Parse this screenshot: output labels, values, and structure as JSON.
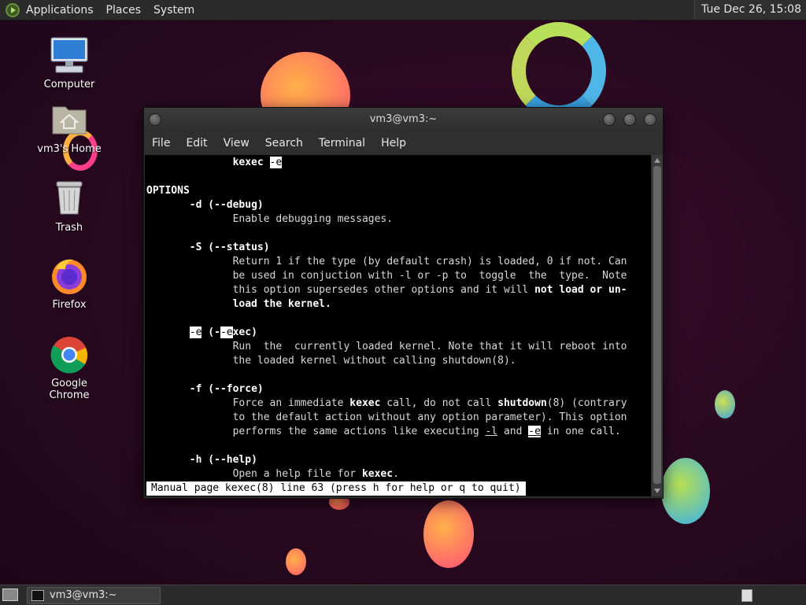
{
  "top_panel": {
    "menus": [
      "Applications",
      "Places",
      "System"
    ],
    "clock": "Tue Dec 26, 15:08"
  },
  "desktop_icons": [
    {
      "label": "Computer",
      "icon": "computer-icon"
    },
    {
      "label": "vm3's Home",
      "icon": "home-folder-icon"
    },
    {
      "label": "Trash",
      "icon": "trash-icon"
    },
    {
      "label": "Firefox",
      "icon": "firefox-icon"
    },
    {
      "label": "Google Chrome",
      "icon": "chrome-icon"
    }
  ],
  "terminal": {
    "title": "vm3@vm3:~",
    "menus": [
      "File",
      "Edit",
      "View",
      "Search",
      "Terminal",
      "Help"
    ],
    "lines": {
      "l1_cmd": "kexec",
      "l1_flag": "-e",
      "options_header": "OPTIONS",
      "d_opt": "-d (--debug)",
      "d_desc": "Enable debugging messages.",
      "s_opt": "-S (--status)",
      "s_desc1": "Return 1 if the type (by default crash) is loaded, 0 if not. Can",
      "s_desc2": "be used in conjuction with -l or -p to  toggle  the  type.  Note",
      "s_desc3a": "this option supersedes other options and it will ",
      "s_desc3b": "not load or un-",
      "s_desc4": "load the kernel.",
      "e_opt_a": "-e",
      "e_opt_b": " (-",
      "e_opt_c": "-e",
      "e_opt_d": "xec)",
      "e_desc1": "Run  the  currently loaded kernel. Note that it will reboot into",
      "e_desc2": "the loaded kernel without calling shutdown(8).",
      "f_opt": "-f (--force)",
      "f_desc1a": "Force an immediate ",
      "f_desc1b": "kexec",
      "f_desc1c": " call, do not call ",
      "f_desc1d": "shutdown",
      "f_desc1e": "(8) (contrary",
      "f_desc2": "to the default action without any option parameter). This option",
      "f_desc3a": "performs the same actions like executing ",
      "f_desc3b": "-l",
      "f_desc3c": " and ",
      "f_desc3d": "-e",
      "f_desc3e": " in one call.",
      "h_opt": "-h (--help)",
      "h_desc_a": "Open a help file for ",
      "h_desc_b": "kexec",
      "h_desc_c": "."
    },
    "status": "Manual page kexec(8) line 63 (press h for help or q to quit)"
  },
  "taskbar": {
    "window_button": "vm3@vm3:~"
  },
  "colors": {
    "panel": "#2b2b2b",
    "terminal_bg": "#000000",
    "wallpaper": "#2a0a22"
  }
}
